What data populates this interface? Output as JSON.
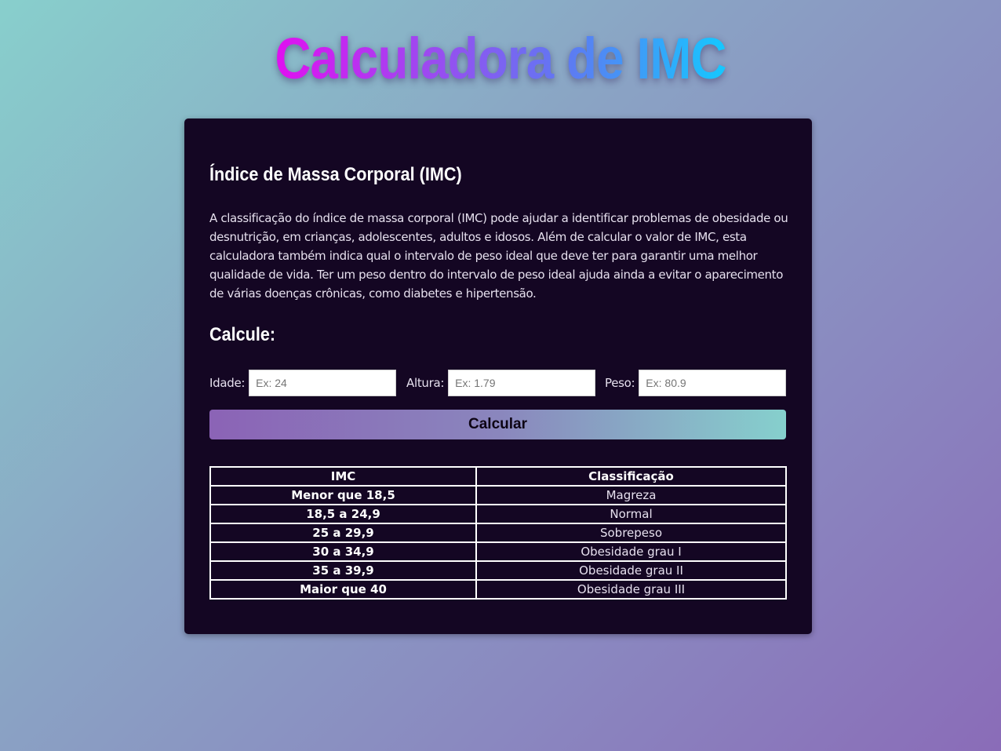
{
  "header": {
    "title": "Calculadora de IMC"
  },
  "card": {
    "section_title": "Índice de Massa Corporal (IMC)",
    "description": "A classificação do índice de massa corporal (IMC) pode ajudar a identificar problemas de obesidade ou desnutrição, em crianças, adolescentes, adultos e idosos. Além de calcular o valor de IMC, esta calculadora também indica qual o intervalo de peso ideal que deve ter para garantir uma melhor qualidade de vida. Ter um peso dentro do intervalo de peso ideal ajuda ainda a evitar o aparecimento de várias doenças crônicas, como diabetes e hipertensão.",
    "calc_title": "Calcule:"
  },
  "form": {
    "idade": {
      "label": "Idade:",
      "placeholder": "Ex: 24",
      "value": ""
    },
    "altura": {
      "label": "Altura:",
      "placeholder": "Ex: 1.79",
      "value": ""
    },
    "peso": {
      "label": "Peso:",
      "placeholder": "Ex: 80.9",
      "value": ""
    },
    "button_label": "Calcular"
  },
  "table": {
    "headers": [
      "IMC",
      "Classificação"
    ],
    "rows": [
      [
        "Menor que 18,5",
        "Magreza"
      ],
      [
        "18,5 a 24,9",
        "Normal"
      ],
      [
        "25 a 29,9",
        "Sobrepeso"
      ],
      [
        "30 a 34,9",
        "Obesidade grau I"
      ],
      [
        "35 a 39,9",
        "Obesidade grau II"
      ],
      [
        "Maior que 40",
        "Obesidade grau III"
      ]
    ]
  }
}
